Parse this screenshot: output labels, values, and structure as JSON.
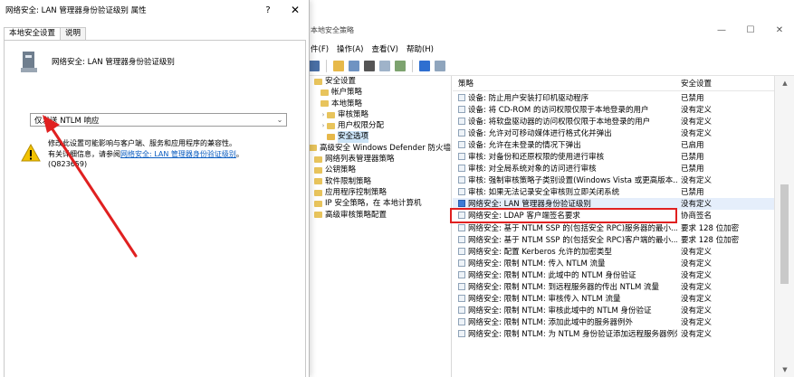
{
  "dialog": {
    "title": "网络安全: LAN 管理器身份验证级别 属性",
    "help": "?",
    "close": "✕",
    "tabs": [
      "本地安全设置",
      "说明"
    ],
    "policy_name": "网络安全: LAN 管理器身份验证级别",
    "selected_value": "仅发送 NTLM 响应",
    "warning_text_1": "修改此设置可能影响与客户端、服务和应用程序的兼容性。",
    "warning_text_2": "有关详细信息，请参阅",
    "warning_link": "网络安全: LAN 管理器身份验证级别",
    "warning_text_3": "。",
    "kb": "(Q823659)"
  },
  "mmc": {
    "title": "本地安全策略",
    "controls": {
      "min": "—",
      "max": "☐",
      "close": "✕"
    },
    "menu": [
      "件(F)",
      "操作(A)",
      "查看(V)",
      "帮助(H)"
    ],
    "tree": [
      {
        "label": "安全设置",
        "depth": 0,
        "caret": ""
      },
      {
        "label": "帐户策略",
        "depth": 1,
        "caret": ""
      },
      {
        "label": "本地策略",
        "depth": 1,
        "caret": ""
      },
      {
        "label": "审核策略",
        "depth": 2,
        "caret": "›"
      },
      {
        "label": "用户权限分配",
        "depth": 2,
        "caret": "›"
      },
      {
        "label": "安全选项",
        "depth": 2,
        "caret": "",
        "selected": true
      },
      {
        "label": "高级安全 Windows Defender 防火墙",
        "depth": 0,
        "caret": ""
      },
      {
        "label": "网络列表管理器策略",
        "depth": 0,
        "caret": ""
      },
      {
        "label": "公钥策略",
        "depth": 0,
        "caret": ""
      },
      {
        "label": "软件限制策略",
        "depth": 0,
        "caret": ""
      },
      {
        "label": "应用程序控制策略",
        "depth": 0,
        "caret": ""
      },
      {
        "label": "IP 安全策略，在 本地计算机",
        "depth": 0,
        "caret": ""
      },
      {
        "label": "高级审核策略配置",
        "depth": 0,
        "caret": ""
      }
    ],
    "columns": {
      "policy": "策略",
      "setting": "安全设置"
    },
    "rows": [
      {
        "policy": "设备: 防止用户安装打印机驱动程序",
        "setting": "已禁用"
      },
      {
        "policy": "设备: 将 CD-ROM 的访问权限仅限于本地登录的用户",
        "setting": "没有定义"
      },
      {
        "policy": "设备: 将软盘驱动器的访问权限仅限于本地登录的用户",
        "setting": "没有定义"
      },
      {
        "policy": "设备: 允许对可移动媒体进行格式化并弹出",
        "setting": "没有定义"
      },
      {
        "policy": "设备: 允许在未登录的情况下弹出",
        "setting": "已启用"
      },
      {
        "policy": "审核: 对备份和还原权限的使用进行审核",
        "setting": "已禁用"
      },
      {
        "policy": "审核: 对全局系统对象的访问进行审核",
        "setting": "已禁用"
      },
      {
        "policy": "审核: 强制审核策略子类别设置(Windows Vista 或更高版本...",
        "setting": "没有定义"
      },
      {
        "policy": "审核: 如果无法记录安全审核则立即关闭系统",
        "setting": "已禁用"
      },
      {
        "policy": "网络安全: LAN 管理器身份验证级别",
        "setting": "没有定义",
        "highlight": true
      },
      {
        "policy": "网络安全: LDAP 客户端签名要求",
        "setting": "协商签名"
      },
      {
        "policy": "网络安全: 基于 NTLM SSP 的(包括安全 RPC)服务器的最小...",
        "setting": "要求 128 位加密"
      },
      {
        "policy": "网络安全: 基于 NTLM SSP 的(包括安全 RPC)客户端的最小...",
        "setting": "要求 128 位加密"
      },
      {
        "policy": "网络安全: 配置 Kerberos 允许的加密类型",
        "setting": "没有定义"
      },
      {
        "policy": "网络安全: 限制 NTLM: 传入 NTLM 流量",
        "setting": "没有定义"
      },
      {
        "policy": "网络安全: 限制 NTLM: 此域中的 NTLM 身份验证",
        "setting": "没有定义"
      },
      {
        "policy": "网络安全: 限制 NTLM: 到远程服务器的传出 NTLM 流量",
        "setting": "没有定义"
      },
      {
        "policy": "网络安全: 限制 NTLM: 审核传入 NTLM 流量",
        "setting": "没有定义"
      },
      {
        "policy": "网络安全: 限制 NTLM: 审核此域中的 NTLM 身份验证",
        "setting": "没有定义"
      },
      {
        "policy": "网络安全: 限制 NTLM: 添加此域中的服务器例外",
        "setting": "没有定义"
      },
      {
        "policy": "网络安全: 限制 NTLM: 为 NTLM 身份验证添加远程服务器例外",
        "setting": "没有定义"
      }
    ]
  },
  "colors": {
    "highlight_box": "#e02020",
    "arrow": "#e02020",
    "link": "#0a5cc0",
    "selection": "#cce4f7"
  }
}
